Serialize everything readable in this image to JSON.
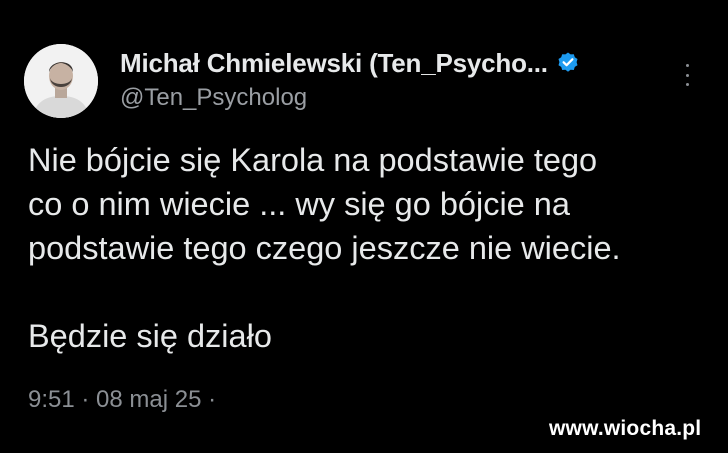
{
  "tweet": {
    "author": {
      "display_name": "Michał Chmielewski (Ten_Psycho...",
      "handle": "@Ten_Psycholog",
      "verified": true,
      "avatar": "avatar-photo"
    },
    "body": {
      "lines": [
        "Nie bójcie się Karola na podstawie tego",
        "co o nim wiecie ... wy się go bójcie na",
        "podstawie tego czego jeszcze nie wiecie."
      ],
      "closing": "Będzie się działo"
    },
    "timestamp": "9:51 · 08 maj 25 ·",
    "more_icon": "more-dots-icon"
  },
  "watermark": {
    "text": "www.wiocha.pl"
  },
  "colors": {
    "background": "#000000",
    "text_primary": "#e7e9ea",
    "text_secondary": "#8b8f94",
    "verified_blue": "#1d9bf0"
  }
}
